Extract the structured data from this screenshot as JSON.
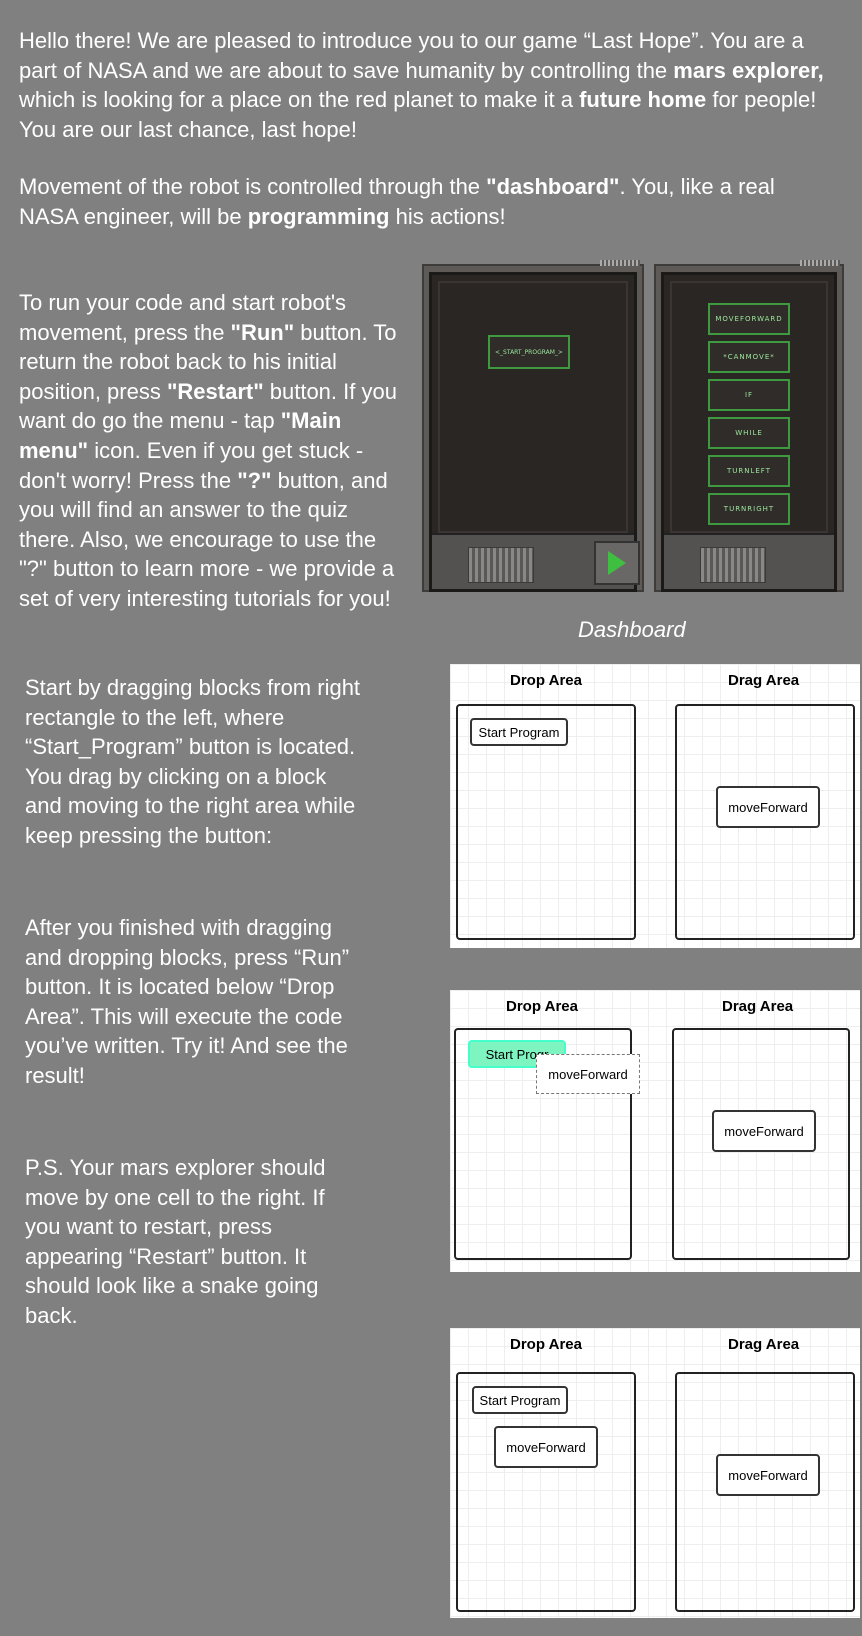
{
  "intro": {
    "part1": "Hello there! We are pleased to introduce you to our game “Last Hope”. You are a part of NASA and we are about to save humanity by controlling the ",
    "bold1": "mars explorer,",
    "part2": " which is looking for a place on the red planet to make it a ",
    "bold2": "future home",
    "part3": " for people! You are our last chance, last hope!"
  },
  "movement": {
    "part1": "Movement of the robot is controlled through the ",
    "bold1": "\"dashboard\"",
    "part2": ". You, like a real NASA engineer, will be ",
    "bold2": "programming",
    "part3": " his actions!"
  },
  "run_help": {
    "part1": "To run your code and start robot's movement, press the ",
    "bold1": "\"Run\"",
    "part2": " button. To return the robot back to his initial position, press ",
    "bold2": "\"Restart\"",
    "part3": " button. If you want do go the menu - tap ",
    "bold3": "\"Main menu\"",
    "part4": " icon. Even if you get stuck - don't worry! Press the ",
    "bold4": "\"?\"",
    "part5": " button, and you will find an answer to the quiz there. Also, we encourage to use the \"?\"  button to learn more - we provide a set of very interesting tutorials  for you!"
  },
  "dashboard": {
    "start_block": "<_start_program_>",
    "commands": [
      "moveForward",
      "*canMove*",
      "if",
      "while",
      "turnLeft",
      "turnRight"
    ],
    "caption": "Dashboard"
  },
  "drag_help": "Start by dragging blocks from right rectangle to the left, where “Start_Program” button is located. You drag by clicking on a block and moving to the right area while keep pressing the button:",
  "run_step": "After you finished with dragging and dropping blocks, press “Run” button. It is located below “Drop Area”. This will execute the code you’ve written. Try it! And see the result!",
  "ps": "P.S. Your mars explorer should move by one cell to the right. If you want to restart, press appearing “Restart” button. It should look like a snake going back.",
  "illustrations": {
    "drop_area": "Drop Area",
    "drag_area": "Drag Area",
    "start_program": "Start Program",
    "start_program_partial": "Start Progr",
    "move_forward": "moveForward"
  }
}
